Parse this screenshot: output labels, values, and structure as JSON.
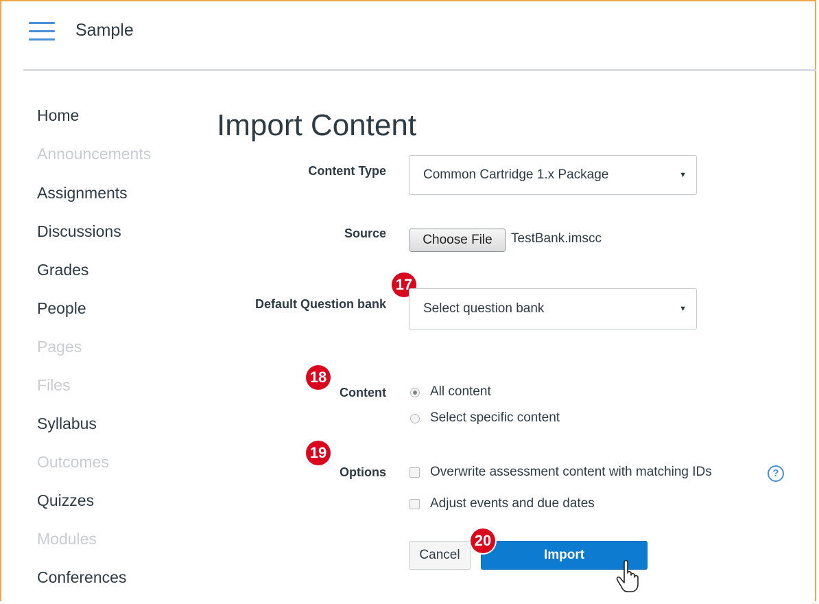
{
  "header": {
    "title": "Sample"
  },
  "nav": {
    "items": [
      {
        "label": "Home",
        "active": true
      },
      {
        "label": "Announcements",
        "active": false
      },
      {
        "label": "Assignments",
        "active": true
      },
      {
        "label": "Discussions",
        "active": true
      },
      {
        "label": "Grades",
        "active": true
      },
      {
        "label": "People",
        "active": true
      },
      {
        "label": "Pages",
        "active": false
      },
      {
        "label": "Files",
        "active": false
      },
      {
        "label": "Syllabus",
        "active": true
      },
      {
        "label": "Outcomes",
        "active": false
      },
      {
        "label": "Quizzes",
        "active": true
      },
      {
        "label": "Modules",
        "active": false
      },
      {
        "label": "Conferences",
        "active": true
      }
    ]
  },
  "page": {
    "title": "Import Content"
  },
  "form": {
    "content_type": {
      "label": "Content Type",
      "value": "Common Cartridge 1.x Package"
    },
    "source": {
      "label": "Source",
      "button": "Choose File",
      "file_name": "TestBank.imscc"
    },
    "question_bank": {
      "label": "Default Question bank",
      "value": "Select question bank"
    },
    "content": {
      "label": "Content",
      "options": [
        {
          "label": "All content",
          "checked": true
        },
        {
          "label": "Select specific content",
          "checked": false
        }
      ]
    },
    "options": {
      "label": "Options",
      "items": [
        {
          "label": "Overwrite assessment content with matching IDs",
          "checked": false
        },
        {
          "label": "Adjust events and due dates",
          "checked": false
        }
      ],
      "help": "?"
    },
    "buttons": {
      "cancel": "Cancel",
      "import": "Import"
    }
  },
  "badges": {
    "b17": "17",
    "b18": "18",
    "b19": "19",
    "b20": "20"
  },
  "colors": {
    "accent": "#0c7bd0",
    "badge": "#d9061e",
    "muted_nav": "#c9cdd1",
    "frame": "#f0a64a"
  },
  "icons": {
    "menu": "hamburger-icon",
    "help": "help-circle-icon",
    "pointer": "hand-pointer-icon",
    "caret": "caret-down-icon"
  }
}
